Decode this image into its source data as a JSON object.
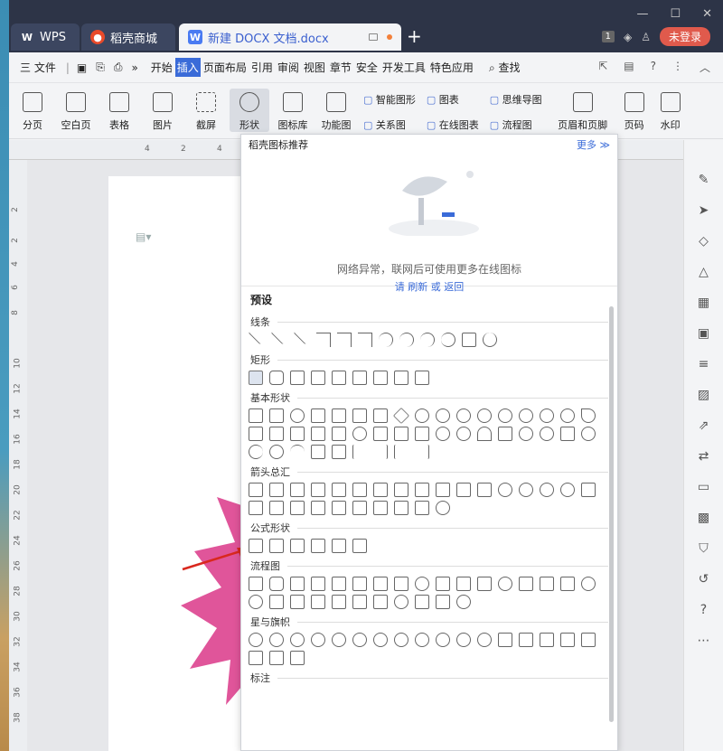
{
  "tabs": {
    "wps": "WPS",
    "mall": "稻壳商城",
    "doc": "新建 DOCX 文档.docx",
    "new_tab": "+"
  },
  "window_controls": {
    "minimize": "—",
    "maximize": "☐",
    "close": "✕"
  },
  "title_right": {
    "badge": "1",
    "login": "未登录"
  },
  "menu": {
    "file": "三 文件",
    "items": [
      "开始",
      "插入",
      "页面布局",
      "引用",
      "审阅",
      "视图",
      "章节",
      "安全",
      "开发工具",
      "特色应用"
    ],
    "active": "插入",
    "search": "查找",
    "help": "?"
  },
  "ribbon": {
    "buttons": [
      "分页",
      "空白页",
      "表格",
      "图片",
      "截屏",
      "形状",
      "图标库",
      "功能图"
    ],
    "active": "形状",
    "small_col1": [
      "智能图形",
      "关系图"
    ],
    "small_col2": [
      "图表",
      "在线图表"
    ],
    "small_col3": [
      "思维导图",
      "流程图"
    ],
    "right_buttons": [
      "页眉和页脚",
      "页码",
      "水印"
    ]
  },
  "ruler": {
    "h_ticks": [
      "4",
      "2",
      "4"
    ],
    "v_ticks": [
      "2",
      "2",
      "4",
      "6",
      "8",
      "10",
      "12",
      "14",
      "16",
      "18",
      "20",
      "22",
      "24",
      "26",
      "28",
      "30",
      "32",
      "34",
      "36",
      "38"
    ]
  },
  "panel": {
    "header": "稻壳图标推荐",
    "more": "更多 ≫",
    "offline_msg": "网络异常，联网后可使用更多在线图标",
    "offline_msg2": "请 刷新 或 返回",
    "preset_title": "预设",
    "categories": {
      "lines": "线条",
      "rect": "矩形",
      "basic": "基本形状",
      "arrows": "箭头总汇",
      "formula": "公式形状",
      "flow": "流程图",
      "stars": "星与旗帜",
      "callouts": "标注"
    }
  },
  "colors": {
    "accent": "#3a6bd8",
    "shape_fill": "#e0559a",
    "arrow": "#d9281e"
  }
}
